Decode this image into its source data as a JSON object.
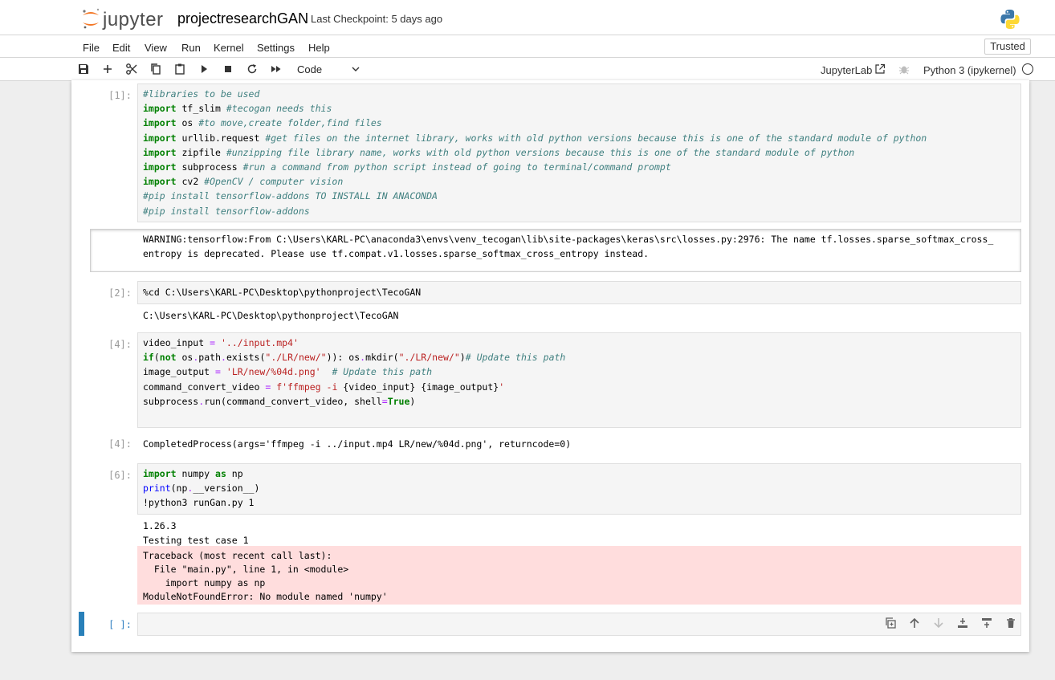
{
  "header": {
    "logo_text": "jupyter",
    "notebook_name": "projectresearchGAN",
    "checkpoint": "Last Checkpoint: 5 days ago"
  },
  "menu": {
    "items": [
      "File",
      "Edit",
      "View",
      "Run",
      "Kernel",
      "Settings",
      "Help"
    ],
    "trusted": "Trusted"
  },
  "toolbar": {
    "cell_type": "Code",
    "jupyterlab": "JupyterLab",
    "kernel": "Python 3 (ipykernel)",
    "icons": [
      "save-icon",
      "add-icon",
      "cut-icon",
      "copy-icon",
      "paste-icon",
      "run-icon",
      "stop-icon",
      "restart-icon",
      "fast-forward-icon"
    ]
  },
  "cells": {
    "c1": {
      "prompt": "[1]:",
      "lines": [
        "#libraries to be used",
        "import tf_slim #tecogan needs this",
        "import os #to move,create folder,find files",
        "import urllib.request #get files on the internet library, works with old python versions because this is one of the standard module of python",
        "import zipfile #unzipping file library name, works with old python versions because this is one of the standard module of python",
        "import subprocess #run a command from python script instead of going to terminal/command prompt",
        "import cv2 #OpenCV / computer vision",
        "#pip install tensorflow-addons TO INSTALL IN ANACONDA",
        "#pip install tensorflow-addons"
      ],
      "output": [
        "WARNING:tensorflow:From C:\\Users\\KARL-PC\\anaconda3\\envs\\venv_tecogan\\lib\\site-packages\\keras\\src\\losses.py:2976: The name tf.losses.sparse_softmax_cross_",
        "entropy is deprecated. Please use tf.compat.v1.losses.sparse_softmax_cross_entropy instead."
      ]
    },
    "c2": {
      "prompt": "[2]:",
      "lines": [
        "%cd C:\\Users\\KARL-PC\\Desktop\\pythonproject\\TecoGAN"
      ],
      "output": [
        "C:\\Users\\KARL-PC\\Desktop\\pythonproject\\TecoGAN"
      ]
    },
    "c4": {
      "prompt": "[4]:",
      "lines": [
        "video_input = '../input.mp4'",
        "if(not os.path.exists(\"./LR/new/\")): os.mkdir(\"./LR/new/\")# Update this path",
        "image_output = 'LR/new/%04d.png'  # Update this path",
        "command_convert_video = f'ffmpeg -i {video_input} {image_output}'",
        "subprocess.run(command_convert_video, shell=True)"
      ],
      "out_prompt": "[4]:",
      "output": [
        "CompletedProcess(args='ffmpeg -i ../input.mp4 LR/new/%04d.png', returncode=0)"
      ]
    },
    "c6": {
      "prompt": "[6]:",
      "lines": [
        "import numpy as np",
        "print(np.__version__)",
        "!python3 runGan.py 1"
      ],
      "output": [
        "1.26.3",
        "Testing test case 1"
      ],
      "error": [
        "Traceback (most recent call last):",
        "  File \"main.py\", line 1, in <module>",
        "    import numpy as np",
        "ModuleNotFoundError: No module named 'numpy'"
      ]
    },
    "c7": {
      "prompt": "[ ]:"
    }
  },
  "cell_tools": [
    "duplicate-icon",
    "move-up-icon",
    "move-down-icon",
    "insert-above-icon",
    "insert-below-icon",
    "delete-icon"
  ]
}
